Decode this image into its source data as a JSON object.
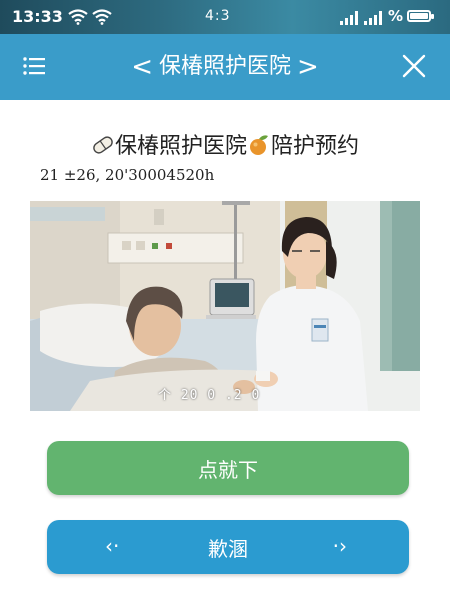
{
  "status_bar": {
    "time": "13:33",
    "center_text": "4:3",
    "battery_label": "%",
    "battery_level": 0.9,
    "icons": [
      "wifi-icon",
      "wifi-icon",
      "signal-icon",
      "signal-icon",
      "battery-icon"
    ]
  },
  "navbar": {
    "title": "保椿照护医院",
    "prev": "<",
    "next": ">",
    "icons": [
      "menu-icon",
      "chevron-left-icon",
      "chevron-right-icon",
      "close-icon"
    ]
  },
  "content": {
    "heading_main": "保椿照护医院",
    "heading_suffix": "陪护预约",
    "heading_icons": [
      "pill-icon",
      "fruit-icon"
    ],
    "subline": "21 ±26, 20'30004520h",
    "photo_stamp": "个 20 0 .2 0"
  },
  "buttons": {
    "primary_label": "点就下",
    "secondary_label": "歉溷",
    "secondary_left_arrow": "‹·",
    "secondary_right_arrow": "·›"
  },
  "colors": {
    "navbar": "#3a9cc9",
    "primary_button": "#62b46f",
    "secondary_button": "#2b9bd0"
  }
}
